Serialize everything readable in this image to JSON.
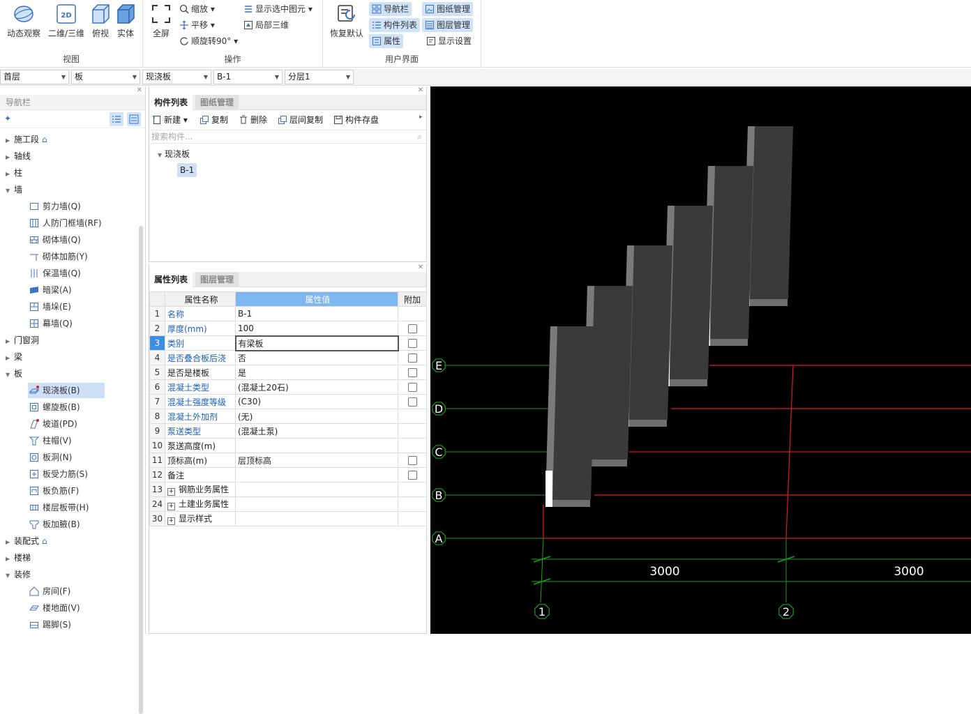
{
  "ribbon": {
    "view": {
      "group_label": "视图",
      "dynamic": "动态观察",
      "twod": "二维/三维",
      "twod_badge": "2D",
      "top": "俯视",
      "solid": "实体"
    },
    "operate": {
      "group_label": "操作",
      "full": "全屏",
      "zoom": "缩放",
      "pan": "平移",
      "rotate": "顺旋转90°",
      "show_selected": "显示选中图元",
      "local3d": "局部三维"
    },
    "ui": {
      "group_label": "用户界面",
      "restore": "恢复默认",
      "nav": "导航栏",
      "complist": "构件列表",
      "prop": "属性",
      "drawing": "图纸管理",
      "layer": "图层管理",
      "display": "显示设置"
    }
  },
  "combos": {
    "floor": "首层",
    "type": "板",
    "sub": "现浇板",
    "comp": "B-1",
    "layer": "分层1"
  },
  "nav": {
    "title": "导航栏",
    "categories": {
      "construction": "施工段",
      "axis": "轴线",
      "column": "柱",
      "wall": "墙",
      "opening": "门窗洞",
      "beam": "梁",
      "slab": "板",
      "prefab": "装配式",
      "stair": "楼梯",
      "decoration": "装修"
    },
    "wall_items": [
      "剪力墙(Q)",
      "人防门框墙(RF)",
      "砌体墙(Q)",
      "砌体加筋(Y)",
      "保温墙(Q)",
      "暗梁(A)",
      "墙垛(E)",
      "幕墙(Q)"
    ],
    "slab_items": [
      "现浇板(B)",
      "螺旋板(B)",
      "坡道(PD)",
      "柱帽(V)",
      "板洞(N)",
      "板受力筋(S)",
      "板负筋(F)",
      "楼层板带(H)",
      "板加腋(B)"
    ],
    "deco_items": [
      "房间(F)",
      "楼地面(V)",
      "踢脚(S)"
    ]
  },
  "complist": {
    "tab1": "构件列表",
    "tab2": "图纸管理",
    "tools": {
      "new": "新建",
      "copy": "复制",
      "del": "删除",
      "floorcopy": "层间复制",
      "save": "构件存盘"
    },
    "search_placeholder": "搜索构件...",
    "tree_root": "现浇板",
    "tree_child": "B-1"
  },
  "props": {
    "tab1": "属性列表",
    "tab2": "图层管理",
    "h_name": "属性名称",
    "h_value": "属性值",
    "h_add": "附加",
    "rows": [
      {
        "n": "1",
        "name": "名称",
        "value": "B-1"
      },
      {
        "n": "2",
        "name": "厚度(mm)",
        "value": "100"
      },
      {
        "n": "3",
        "name": "类别",
        "value": "有梁板"
      },
      {
        "n": "4",
        "name": "是否叠合板后浇",
        "value": "否"
      },
      {
        "n": "5",
        "name": "是否是楼板",
        "value": "是"
      },
      {
        "n": "6",
        "name": "混凝土类型",
        "value": "(混凝土20石)"
      },
      {
        "n": "7",
        "name": "混凝土强度等级",
        "value": "(C30)"
      },
      {
        "n": "8",
        "name": "混凝土外加剂",
        "value": "(无)"
      },
      {
        "n": "9",
        "name": "泵送类型",
        "value": "(混凝土泵)"
      },
      {
        "n": "10",
        "name": "泵送高度(m)",
        "value": ""
      },
      {
        "n": "11",
        "name": "顶标高(m)",
        "value": "层顶标高"
      },
      {
        "n": "12",
        "name": "备注",
        "value": ""
      },
      {
        "n": "13",
        "name": "钢筋业务属性",
        "value": ""
      },
      {
        "n": "24",
        "name": "土建业务属性",
        "value": ""
      },
      {
        "n": "30",
        "name": "显示样式",
        "value": ""
      }
    ]
  },
  "canvas": {
    "axes_h": [
      "E",
      "D",
      "C",
      "B",
      "A"
    ],
    "axes_v": [
      "1",
      "2"
    ],
    "dims": [
      "3000",
      "3000"
    ]
  }
}
